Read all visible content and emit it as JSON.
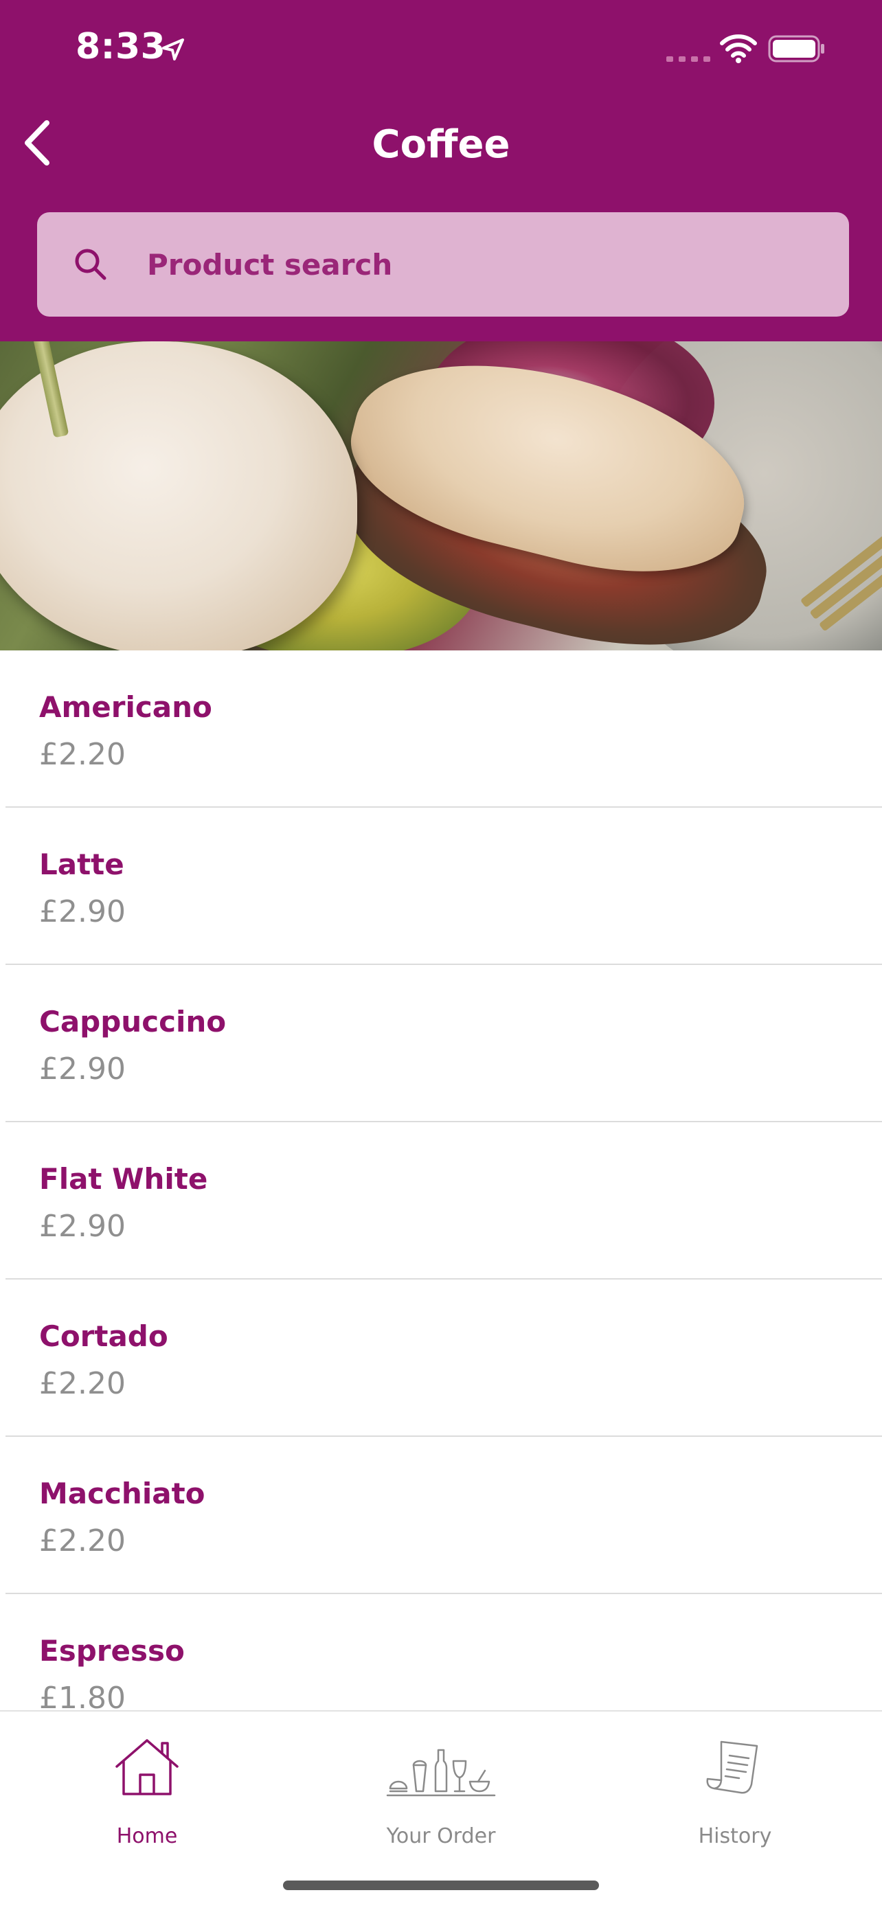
{
  "status_bar": {
    "time": "8:33",
    "icons": [
      "location-arrow-icon",
      "cellular-signal-icon",
      "wifi-icon",
      "battery-icon"
    ]
  },
  "header": {
    "title": "Coffee",
    "back_icon": "chevron-left-icon",
    "background_color": "#8e116b"
  },
  "search": {
    "placeholder": "Product search",
    "icon": "search-icon",
    "background_color": "#dfb3d1"
  },
  "hero": {
    "image": "sandwich-photo"
  },
  "products": [
    {
      "name": "Americano",
      "price": "£2.20"
    },
    {
      "name": "Latte",
      "price": "£2.90"
    },
    {
      "name": "Cappuccino",
      "price": "£2.90"
    },
    {
      "name": "Flat White",
      "price": "£2.90"
    },
    {
      "name": "Cortado",
      "price": "£2.20"
    },
    {
      "name": "Macchiato",
      "price": "£2.20"
    },
    {
      "name": "Espresso",
      "price": "£1.80"
    }
  ],
  "tabs": [
    {
      "label": "Home",
      "icon": "house-icon",
      "active": true
    },
    {
      "label": "Your Order",
      "icon": "food-drinks-icon",
      "active": false
    },
    {
      "label": "History",
      "icon": "receipt-icon",
      "active": false
    }
  ],
  "colors": {
    "accent": "#8e116b",
    "price_text": "#8f8f8f",
    "inactive_tab": "#8a8a8a",
    "divider": "#dcdcdc"
  }
}
